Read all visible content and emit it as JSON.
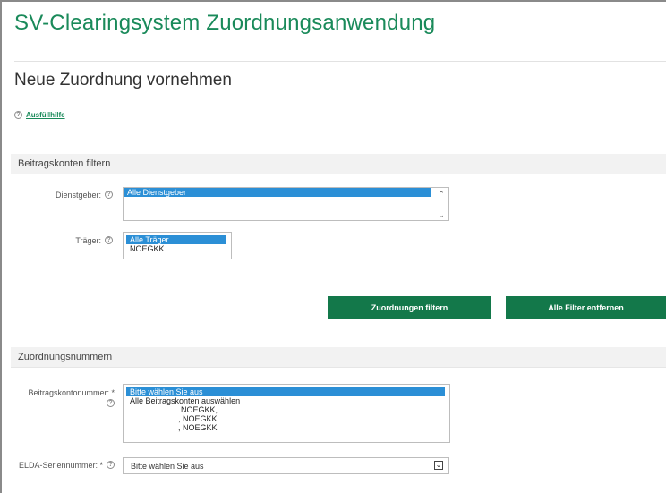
{
  "app": {
    "title": "SV-Clearingsystem Zuordnungsanwendung"
  },
  "page": {
    "heading": "Neue Zuordnung vornehmen"
  },
  "help_link": {
    "label": "Ausfüllhilfe",
    "icon": "help-circle-icon"
  },
  "filter_section": {
    "title": "Beitragskonten filtern",
    "dienstgeber": {
      "label": "Dienstgeber:",
      "options": [
        "Alle Dienstgeber"
      ],
      "selected": "Alle Dienstgeber"
    },
    "traeger": {
      "label": "Träger:",
      "options": [
        "Alle Träger",
        "NOEGKK"
      ],
      "selected": "Alle Träger"
    },
    "buttons": {
      "filter": "Zuordnungen filtern",
      "clear": "Alle Filter entfernen"
    }
  },
  "numbers_section": {
    "title": "Zuordnungsnummern",
    "beitragskontonummer": {
      "label": "Beitragskontonummer: *",
      "options": [
        "Bitte wählen Sie aus",
        "Alle Beitragskonten auswählen",
        "NOEGKK,",
        ", NOEGKK",
        ", NOEGKK"
      ],
      "selected": "Bitte wählen Sie aus"
    },
    "elda": {
      "label": "ELDA-Seriennummer: *",
      "value": "Bitte wählen Sie aus"
    }
  },
  "colors": {
    "brand_green": "#13784a",
    "title_green": "#1a8a5a",
    "selection_blue": "#2b8fd6"
  }
}
